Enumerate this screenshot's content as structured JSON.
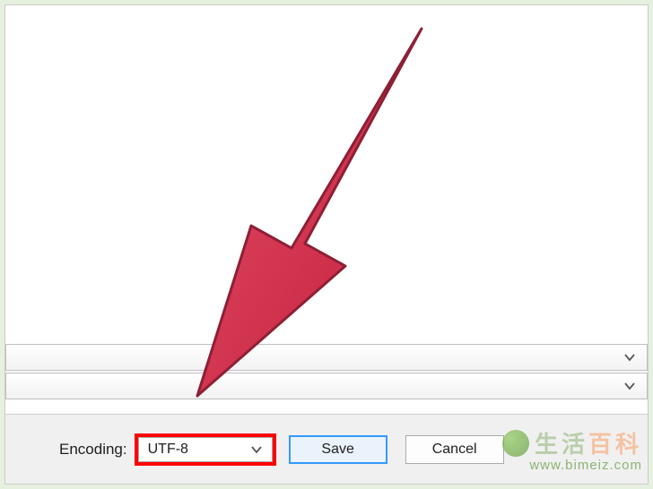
{
  "bottomBar": {
    "encodingLabel": "Encoding:",
    "encodingValue": "UTF-8",
    "saveLabel": "Save",
    "cancelLabel": "Cancel"
  },
  "watermark": {
    "textMain": "生活",
    "textAccent": "百科",
    "url": "www.bimeiz.com"
  },
  "colors": {
    "highlight": "#ff0000",
    "arrowFill": "#d9304f",
    "arrowStroke": "#8e1f35"
  }
}
